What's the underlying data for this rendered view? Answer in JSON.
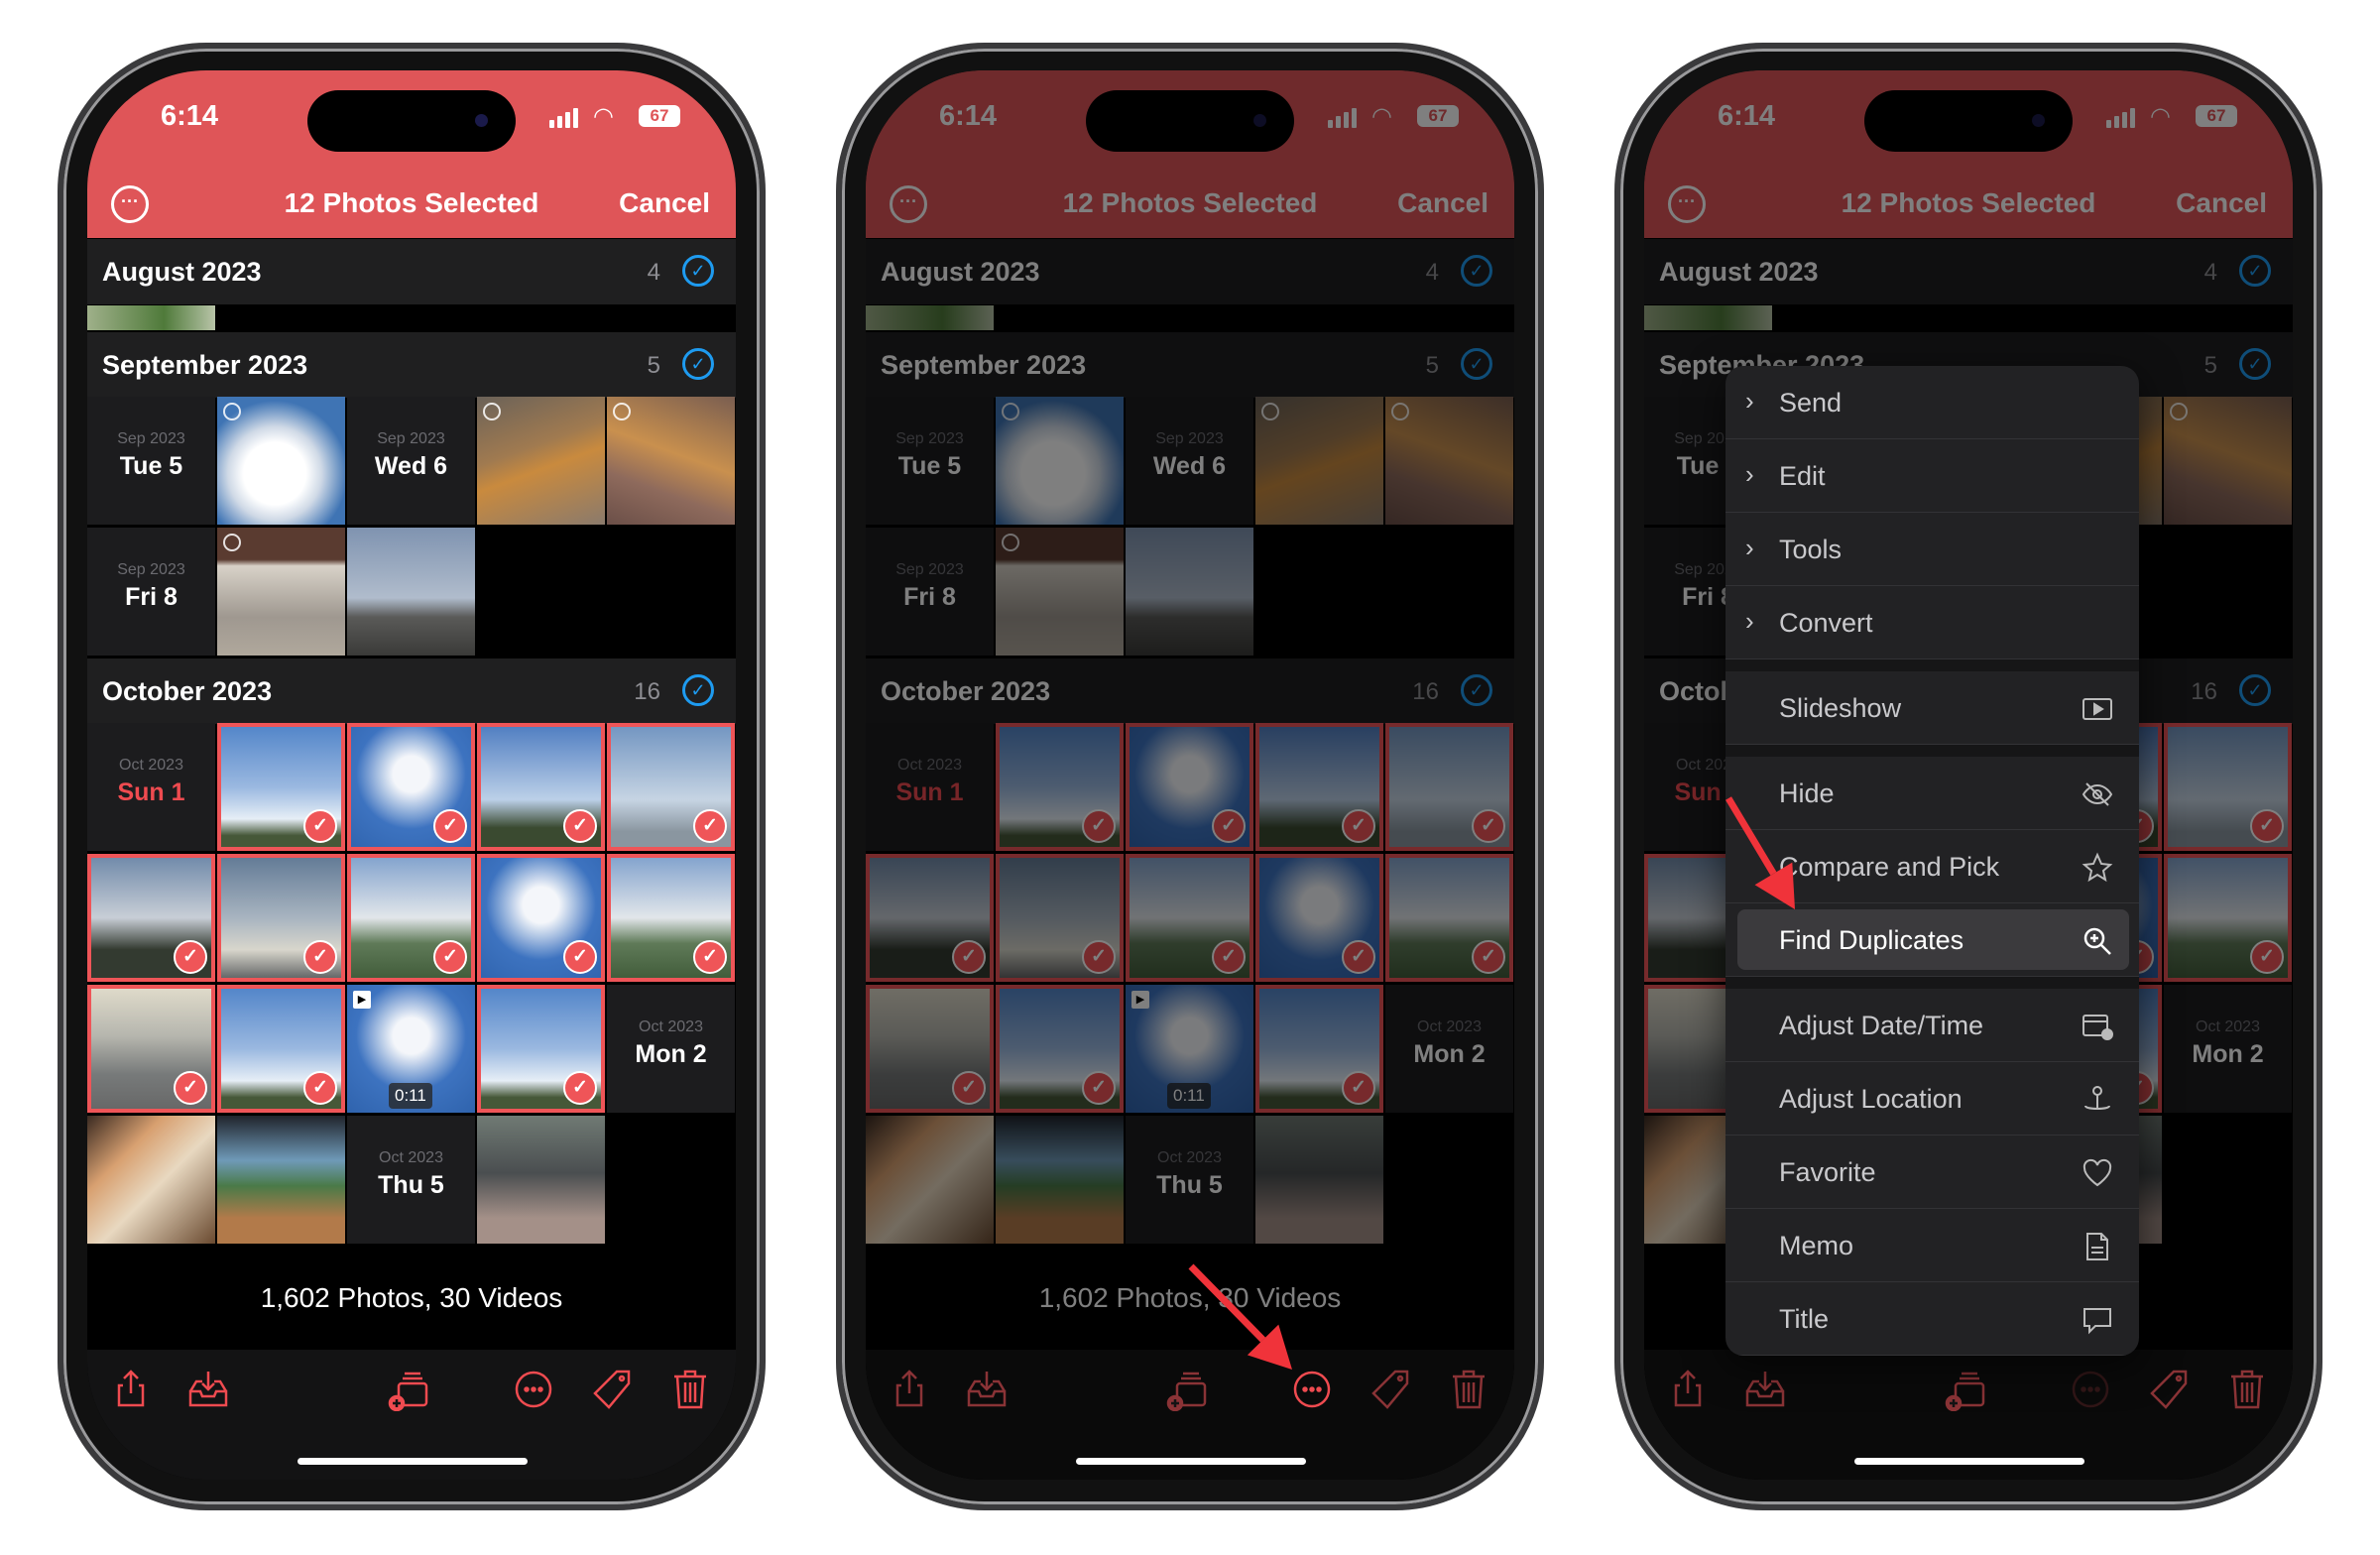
{
  "status": {
    "time": "6:14",
    "battery": "67"
  },
  "nav": {
    "title": "12 Photos Selected",
    "cancel": "Cancel"
  },
  "sections": [
    {
      "label": "August 2023",
      "count": "4"
    },
    {
      "label": "September 2023",
      "count": "5"
    },
    {
      "label": "October 2023",
      "count": "16"
    }
  ],
  "september_rows": [
    [
      {
        "type": "date",
        "month": "Sep 2023",
        "day": "Tue 5"
      },
      {
        "type": "photo",
        "kind": "sky-cloud",
        "live": true
      },
      {
        "type": "date",
        "month": "Sep 2023",
        "day": "Wed 6"
      },
      {
        "type": "photo",
        "kind": "cat-orange",
        "live": true
      },
      {
        "type": "photo",
        "kind": "cat-orange-lying",
        "live": true
      }
    ],
    [
      {
        "type": "date",
        "month": "Sep 2023",
        "day": "Fri 8"
      },
      {
        "type": "photo",
        "kind": "pavilion",
        "live": true
      },
      {
        "type": "photo",
        "kind": "bird"
      }
    ]
  ],
  "october_rows": [
    [
      {
        "type": "date",
        "month": "Oct 2023",
        "day": "Sun 1",
        "today": true
      },
      {
        "type": "photo",
        "kind": "sky",
        "selected": true
      },
      {
        "type": "photo",
        "kind": "sky-deep",
        "selected": true
      },
      {
        "type": "photo",
        "kind": "sky-tree",
        "selected": true
      },
      {
        "type": "photo",
        "kind": "sky-pale",
        "selected": true
      }
    ],
    [
      {
        "type": "photo",
        "kind": "sky-dusk",
        "selected": true
      },
      {
        "type": "photo",
        "kind": "sky-grey",
        "selected": true
      },
      {
        "type": "photo",
        "kind": "sky-hill",
        "selected": true
      },
      {
        "type": "photo",
        "kind": "sky-deep",
        "selected": true
      },
      {
        "type": "photo",
        "kind": "sky-hill",
        "selected": true
      }
    ],
    [
      {
        "type": "photo",
        "kind": "city-haze",
        "selected": true
      },
      {
        "type": "photo",
        "kind": "sky",
        "selected": true
      },
      {
        "type": "video",
        "kind": "sky-deep",
        "duration": "0:11"
      },
      {
        "type": "photo",
        "kind": "sky",
        "selected": true
      },
      {
        "type": "date",
        "month": "Oct 2023",
        "day": "Mon 2"
      }
    ],
    [
      {
        "type": "photo",
        "kind": "food"
      },
      {
        "type": "photo",
        "kind": "cafe"
      },
      {
        "type": "date",
        "month": "Oct 2023",
        "day": "Thu 5"
      },
      {
        "type": "photo",
        "kind": "cat-street"
      }
    ]
  ],
  "footer": "1,602 Photos, 30 Videos",
  "toolbar": [
    "share-icon",
    "import-icon",
    "add-to-album-icon",
    "more-icon",
    "tag-icon",
    "trash-icon"
  ],
  "menu": [
    {
      "label": "Send",
      "submenu": true
    },
    {
      "label": "Edit",
      "submenu": true
    },
    {
      "label": "Tools",
      "submenu": true
    },
    {
      "label": "Convert",
      "submenu": true,
      "group_end": true
    },
    {
      "label": "Slideshow",
      "icon": "slideshow-icon",
      "group_end": true
    },
    {
      "label": "Hide",
      "icon": "eye-slash-icon"
    },
    {
      "label": "Compare and Pick",
      "icon": "star-icon"
    },
    {
      "label": "Find Duplicates",
      "icon": "magnify-plus-icon",
      "highlighted": true,
      "group_end": true
    },
    {
      "label": "Adjust Date/Time",
      "icon": "calendar-clock-icon"
    },
    {
      "label": "Adjust Location",
      "icon": "location-pin-icon"
    },
    {
      "label": "Favorite",
      "icon": "heart-icon"
    },
    {
      "label": "Memo",
      "icon": "document-icon"
    },
    {
      "label": "Title",
      "icon": "speech-bubble-icon"
    }
  ],
  "colors": {
    "accent": "#df5558",
    "select": "#ef5558",
    "check_blue": "#1e9bf0",
    "annotation_arrow": "#f0333a"
  }
}
